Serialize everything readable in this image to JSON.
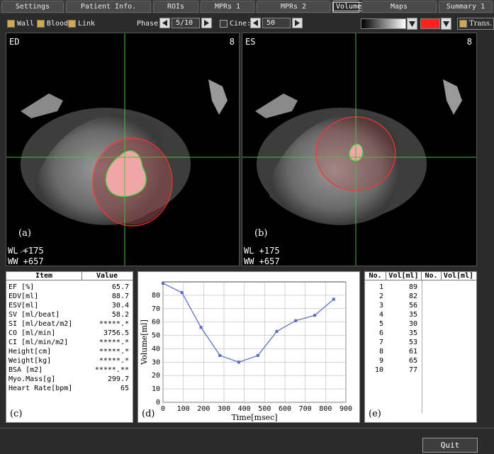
{
  "tabs": [
    {
      "label": "Settings"
    },
    {
      "label": "Patient Info."
    },
    {
      "label": "ROIs"
    },
    {
      "label": "MPRs 1"
    },
    {
      "label": "MPRs 2"
    },
    {
      "label": "Volume"
    },
    {
      "label": "Maps"
    },
    {
      "label": "Summary 1"
    }
  ],
  "toolbar": {
    "wall": "Wall",
    "blood": "Blood",
    "link": "Link",
    "phase_label": "Phase:",
    "phase_value": "5/10",
    "cine_label": "Cine:",
    "cine_value": "50",
    "trans": "Trans.",
    "color_swatch": "#ff2020"
  },
  "left_image": {
    "phase": "ED",
    "slice": "8",
    "panel_label": "(a)",
    "wl": "WL +175",
    "ww": "WW +657"
  },
  "right_image": {
    "phase": "ES",
    "slice": "8",
    "panel_label": "(b)",
    "wl": "WL +175",
    "ww": "WW +657"
  },
  "results": {
    "header_item": "Item",
    "header_value": "Value",
    "rows": [
      {
        "item": "EF [%]",
        "value": "65.7"
      },
      {
        "item": "EDV[ml]",
        "value": "88.7"
      },
      {
        "item": "ESV[ml]",
        "value": "30.4"
      },
      {
        "item": "SV [ml/beat]",
        "value": "58.2"
      },
      {
        "item": "SI [ml/beat/m2]",
        "value": "*****.*"
      },
      {
        "item": "CO [ml/min]",
        "value": "3756.5"
      },
      {
        "item": "CI [ml/min/m2]",
        "value": "*****.*"
      },
      {
        "item": "Height[cm]",
        "value": "*****.*"
      },
      {
        "item": "Weight[kg]",
        "value": "*****.*"
      },
      {
        "item": "BSA [m2]",
        "value": "*****.**"
      },
      {
        "item": "Myo.Mass[g]",
        "value": "299.7"
      },
      {
        "item": "Heart Rate[bpm]",
        "value": "65"
      }
    ],
    "panel_label": "(c)"
  },
  "chart_panel_label": "(d)",
  "chart_data": {
    "type": "line",
    "xlabel": "Time[msec]",
    "ylabel": "Volume[ml]",
    "x": [
      0,
      93,
      187,
      280,
      373,
      467,
      560,
      653,
      747,
      840
    ],
    "series": [
      {
        "values": [
          89,
          82,
          56,
          35,
          30,
          35,
          53,
          61,
          65,
          77
        ]
      }
    ],
    "xlim": [
      0,
      900
    ],
    "ylim": [
      0,
      90
    ],
    "xticks": [
      0,
      100,
      200,
      300,
      400,
      500,
      600,
      700,
      800,
      900
    ],
    "yticks": [
      0,
      10,
      20,
      30,
      40,
      50,
      60,
      70,
      80
    ],
    "grid": true,
    "color": "#5566cc"
  },
  "volumes": {
    "headers": [
      "No.",
      "Vol[ml]",
      "No.",
      "Vol[ml]"
    ],
    "rows": [
      {
        "no": "1",
        "vol": "89"
      },
      {
        "no": "2",
        "vol": "82"
      },
      {
        "no": "3",
        "vol": "56"
      },
      {
        "no": "4",
        "vol": "35"
      },
      {
        "no": "5",
        "vol": "30"
      },
      {
        "no": "6",
        "vol": "35"
      },
      {
        "no": "7",
        "vol": "53"
      },
      {
        "no": "8",
        "vol": "61"
      },
      {
        "no": "9",
        "vol": "65"
      },
      {
        "no": "10",
        "vol": "77"
      }
    ],
    "panel_label": "(e)"
  },
  "quit_label": "Quit"
}
